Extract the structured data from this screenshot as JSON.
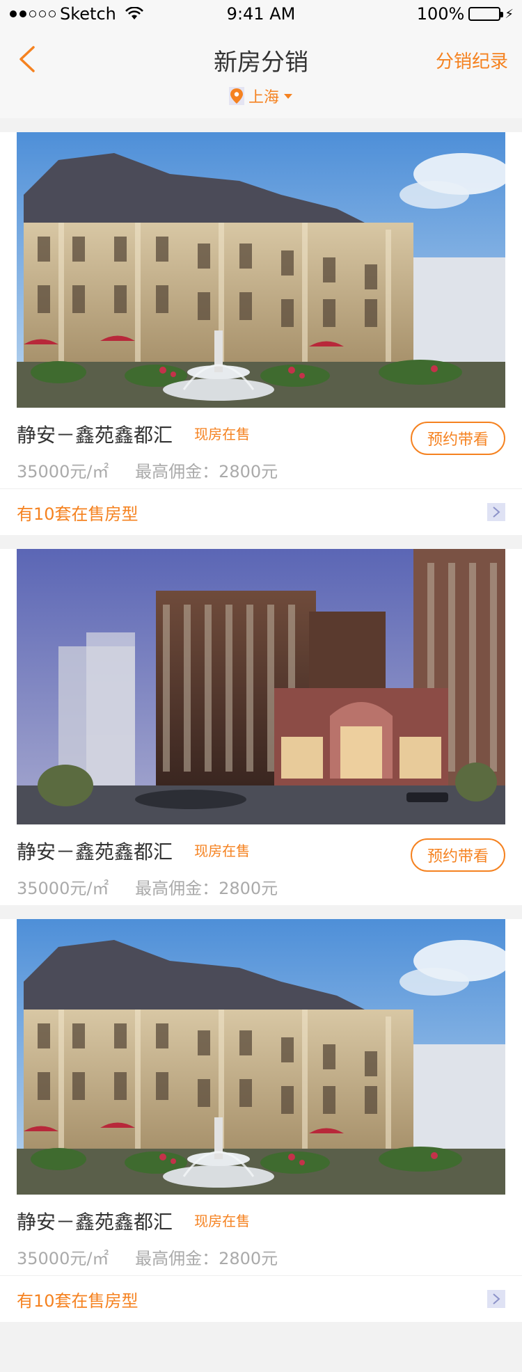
{
  "status": {
    "carrier": "Sketch",
    "time": "9:41 AM",
    "battery": "100%"
  },
  "nav": {
    "title": "新房分销",
    "right_link": "分销纪录",
    "city": "上海"
  },
  "colors": {
    "accent": "#f58220",
    "background": "#f2f2f2",
    "text": "#333333",
    "muted": "#aaaaaa"
  },
  "listings": [
    {
      "name": "静安－鑫苑鑫都汇",
      "status": "现房在售",
      "price": "35000元/㎡",
      "commission": "最高佣金：2800元",
      "button": "预约带看",
      "types_text": "有10套在售房型",
      "image": "villa-building"
    },
    {
      "name": "静安－鑫苑鑫都汇",
      "status": "现房在售",
      "price": "35000元/㎡",
      "commission": "最高佣金：2800元",
      "button": "预约带看",
      "image": "tower-building"
    },
    {
      "name": "静安－鑫苑鑫都汇",
      "status": "现房在售",
      "price": "35000元/㎡",
      "commission": "最高佣金：2800元",
      "types_text": "有10套在售房型",
      "image": "villa-building"
    }
  ]
}
